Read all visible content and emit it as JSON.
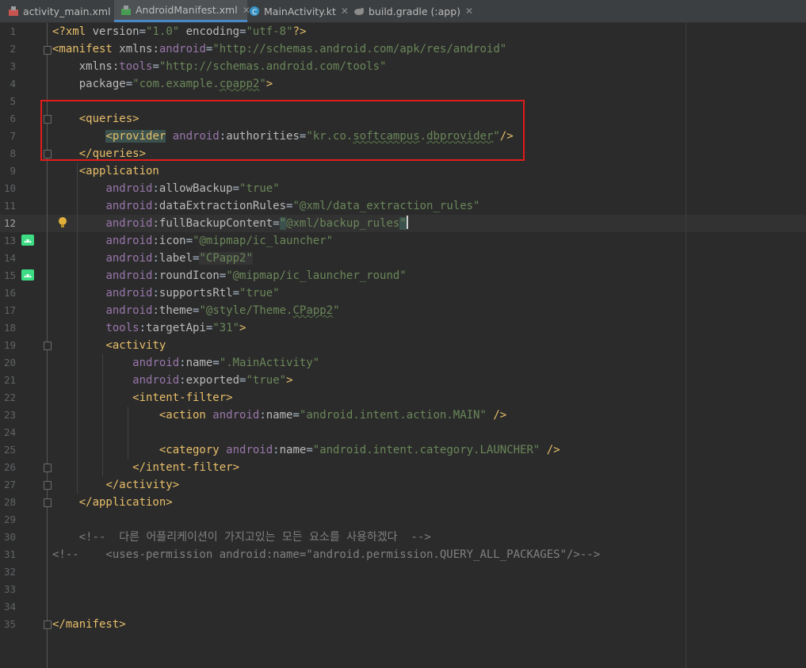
{
  "tabs": [
    {
      "label": "activity_main.xml",
      "icon": "xml-layout-icon",
      "active": false
    },
    {
      "label": "AndroidManifest.xml",
      "icon": "manifest-file-icon",
      "active": true
    },
    {
      "label": "MainActivity.kt",
      "icon": "kotlin-class-icon",
      "active": false
    },
    {
      "label": "build.gradle (:app)",
      "icon": "gradle-icon",
      "active": false
    }
  ],
  "editor": {
    "current_line": 12,
    "line_numbers": [
      "1",
      "2",
      "3",
      "4",
      "5",
      "6",
      "7",
      "8",
      "9",
      "10",
      "11",
      "12",
      "13",
      "14",
      "15",
      "16",
      "17",
      "18",
      "19",
      "20",
      "21",
      "22",
      "23",
      "24",
      "25",
      "26",
      "27",
      "28",
      "29",
      "30",
      "31",
      "32",
      "33",
      "34",
      "35"
    ],
    "highlight_box_color": "#e31b1b",
    "lines": {
      "l1_prolog": "<?xml ",
      "l1_version_key": "version",
      "l1_version_val": "\"1.0\"",
      "l1_encoding_key": "encoding",
      "l1_encoding_val": "\"utf-8\"",
      "l1_end": "?>",
      "l2_tag": "<manifest ",
      "l2_xmlns": "xmlns:",
      "l2_android": "android",
      "l2_val": "\"http://schemas.android.com/apk/res/android\"",
      "l3_xmlns": "xmlns:",
      "l3_tools": "tools",
      "l3_val": "\"http://schemas.android.com/tools\"",
      "l4_key": "package",
      "l4_val_a": "\"com.example.",
      "l4_val_b": "cpapp2",
      "l4_val_c": "\"",
      "l4_end": ">",
      "l6": "<queries>",
      "l7_tag": "<provider",
      "l7_ns": "android",
      "l7_attr": "authorities",
      "l7_val_a": "\"kr.co.",
      "l7_val_b": "softcampus",
      "l7_val_c": ".",
      "l7_val_d": "dbprovider",
      "l7_val_e": "\"",
      "l7_end": "/>",
      "l8": "</queries>",
      "l9": "<application",
      "l10_attr": "allowBackup",
      "l10_val": "\"true\"",
      "l11_attr": "dataExtractionRules",
      "l11_val": "\"@xml/data_extraction_rules\"",
      "l12_attr": "fullBackupContent",
      "l12_val_a": "\"",
      "l12_val_b": "@xml/backup_rules",
      "l12_val_c": "\"",
      "l13_attr": "icon",
      "l13_val": "\"@mipmap/ic_launcher\"",
      "l14_attr": "label",
      "l14_val": "\"CPapp2\"",
      "l15_attr": "roundIcon",
      "l15_val": "\"@mipmap/ic_launcher_round\"",
      "l16_attr": "supportsRtl",
      "l16_val": "\"true\"",
      "l17_attr": "theme",
      "l17_val_a": "\"@style/Theme.",
      "l17_val_b": "CPapp2",
      "l17_val_c": "\"",
      "l18_ns": "tools",
      "l18_attr": "targetApi",
      "l18_val": "\"31\"",
      "l18_end": ">",
      "l19": "<activity",
      "l20_attr": "name",
      "l20_val": "\".MainActivity\"",
      "l21_attr": "exported",
      "l21_val": "\"true\"",
      "l21_end": ">",
      "l22": "<intent-filter>",
      "l23_tag": "<action ",
      "l23_attr": "name",
      "l23_val": "\"android.intent.action.MAIN\"",
      "l23_end": " />",
      "l25_tag": "<category ",
      "l25_attr": "name",
      "l25_val": "\"android.intent.category.LAUNCHER\"",
      "l25_end": " />",
      "l26": "</intent-filter>",
      "l27": "</activity>",
      "l28": "</application>",
      "l30": "<!--  다른 어플리케이션이 가지고있는 모든 요소를 사용하겠다  -->",
      "l31": "<!--    <uses-permission android:name=\"android.permission.QUERY_ALL_PACKAGES\"/>-->",
      "l35": "</manifest>",
      "ns_android": "android",
      "colon": ":",
      "eq": "="
    }
  },
  "colors": {
    "background": "#2b2b2b",
    "tag": "#e8bf6a",
    "string": "#6a8759",
    "namespace": "#9876aa",
    "comment": "#808080"
  }
}
